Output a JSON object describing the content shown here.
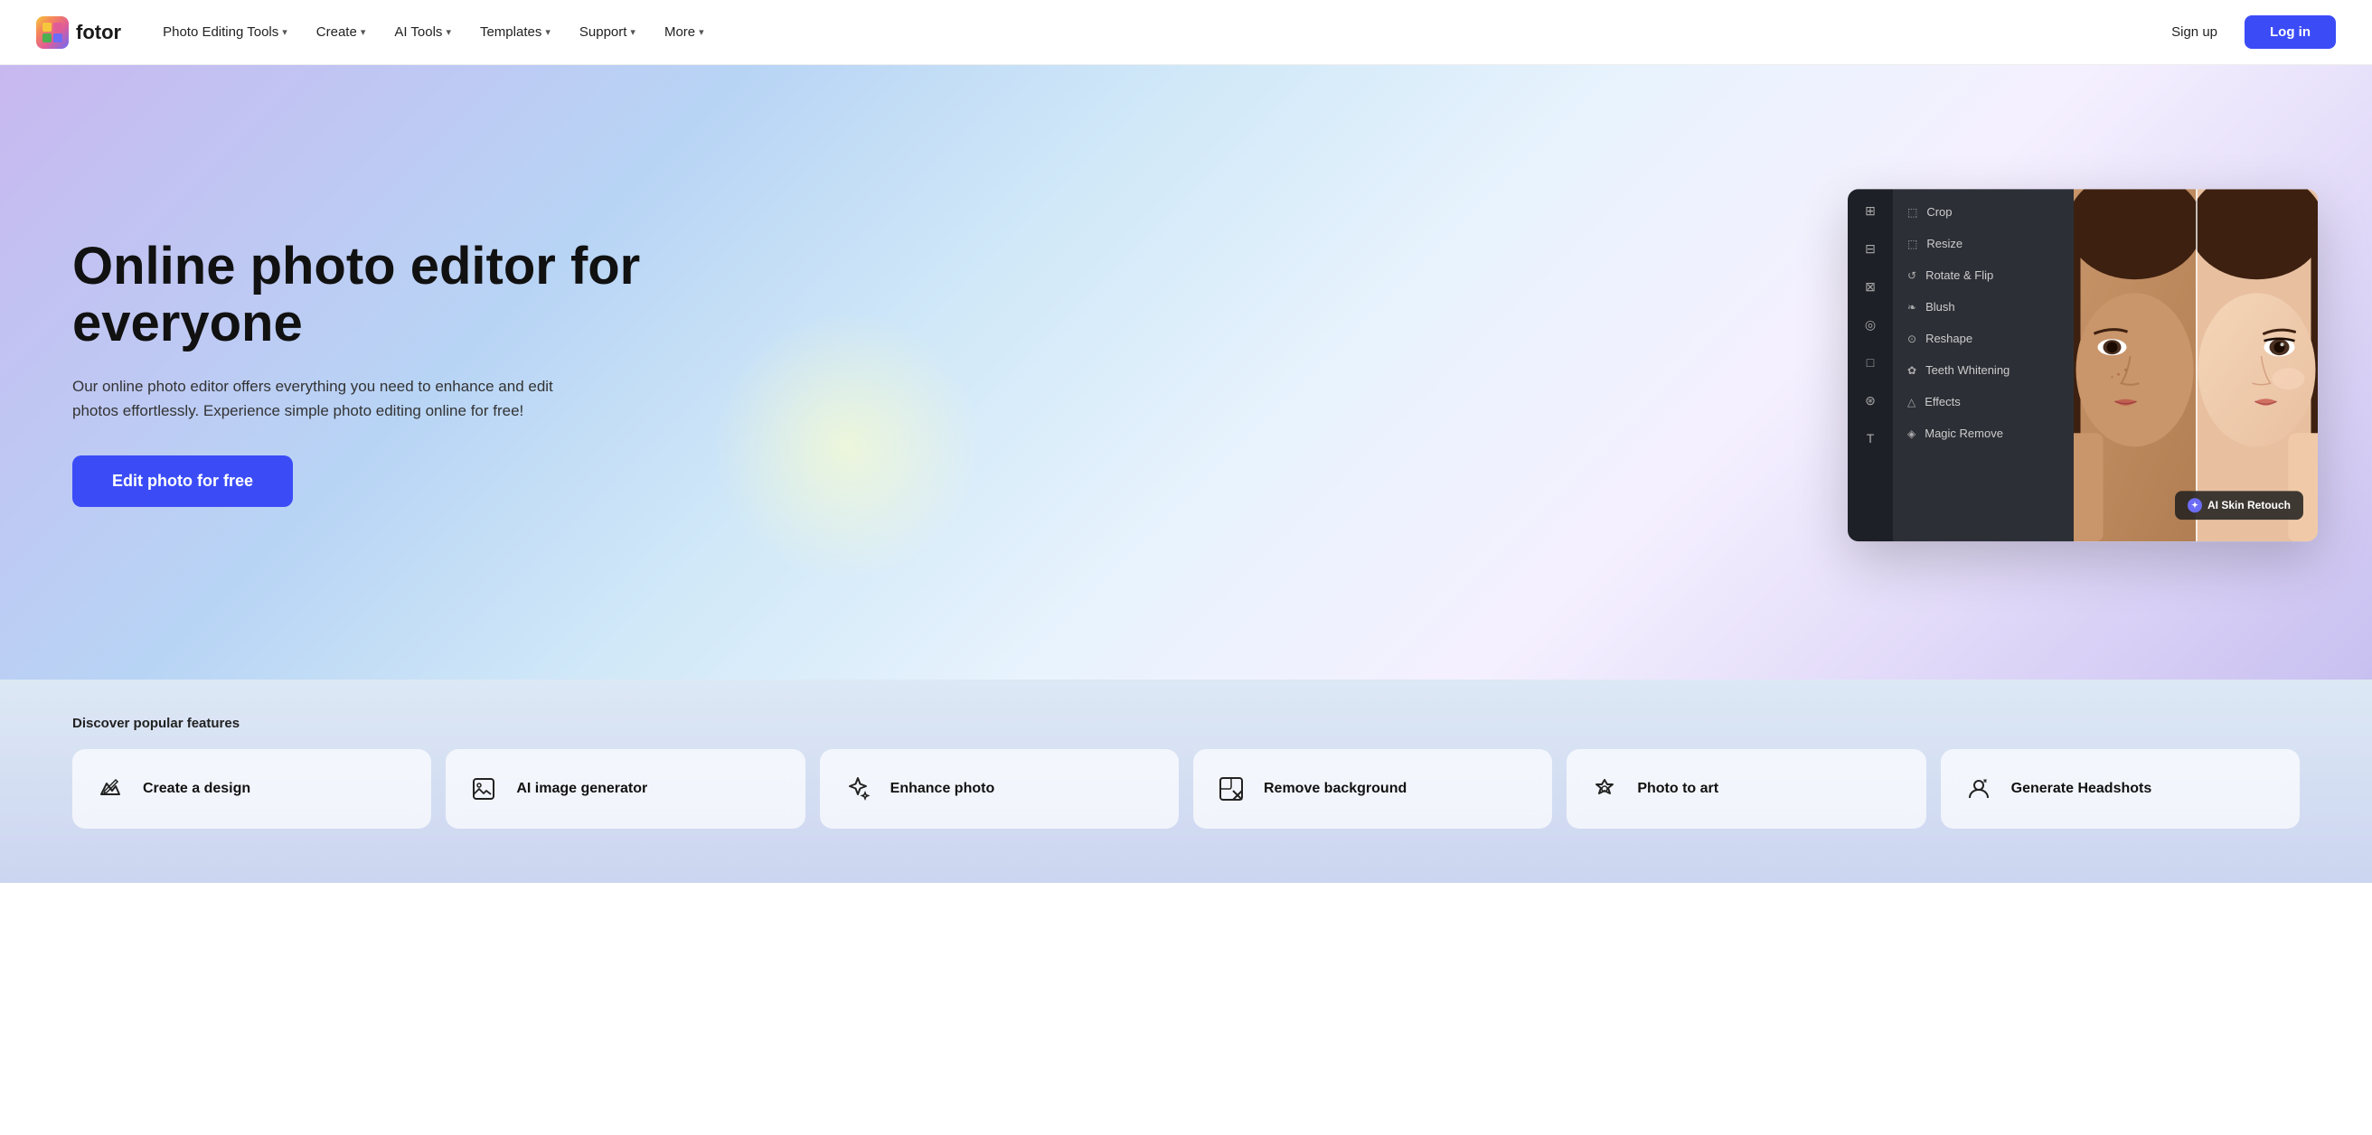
{
  "brand": {
    "name": "fotor",
    "logo_emoji": "🟡"
  },
  "nav": {
    "items": [
      {
        "label": "Photo Editing Tools",
        "has_dropdown": true
      },
      {
        "label": "Create",
        "has_dropdown": true
      },
      {
        "label": "AI Tools",
        "has_dropdown": true
      },
      {
        "label": "Templates",
        "has_dropdown": true
      },
      {
        "label": "Support",
        "has_dropdown": true
      },
      {
        "label": "More",
        "has_dropdown": true
      }
    ],
    "signup_label": "Sign up",
    "login_label": "Log in"
  },
  "hero": {
    "title": "Online photo editor for everyone",
    "subtitle": "Our online photo editor offers everything you need to enhance and edit photos effortlessly. Experience simple photo editing online for free!",
    "cta_label": "Edit photo for free"
  },
  "editor_preview": {
    "menu_items": [
      {
        "icon": "⬜",
        "label": "Crop"
      },
      {
        "icon": "⬜",
        "label": "Resize"
      },
      {
        "icon": "↺",
        "label": "Rotate & Flip"
      },
      {
        "icon": "💄",
        "label": "Blush"
      },
      {
        "icon": "⬜",
        "label": "Reshape"
      },
      {
        "icon": "🦷",
        "label": "Teeth Whitening"
      },
      {
        "icon": "✨",
        "label": "Effects"
      },
      {
        "icon": "✂️",
        "label": "Magic Remove"
      }
    ],
    "ai_badge_text": "AI Skin Retouch"
  },
  "features": {
    "section_label": "Discover popular features",
    "cards": [
      {
        "icon": "✏️",
        "label": "Create a design"
      },
      {
        "icon": "🖼️",
        "label": "AI image generator"
      },
      {
        "icon": "⭐",
        "label": "Enhance photo"
      },
      {
        "icon": "📋",
        "label": "Remove background"
      },
      {
        "icon": "◈",
        "label": "Photo to art"
      },
      {
        "icon": "👤",
        "label": "Generate Headshots"
      }
    ]
  }
}
